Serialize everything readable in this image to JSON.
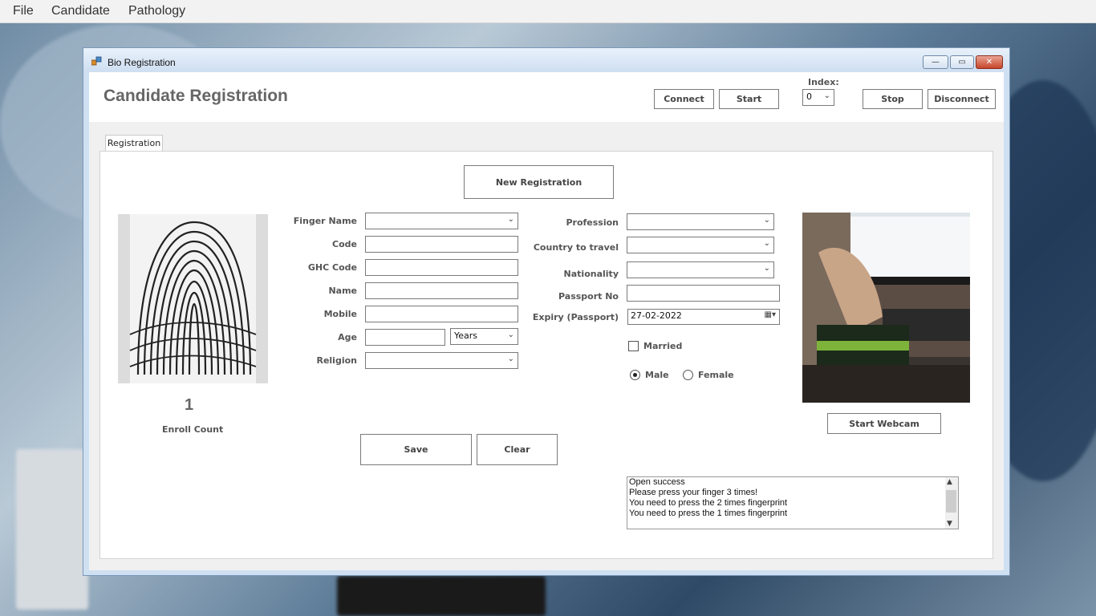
{
  "menubar": {
    "items": [
      "File",
      "Candidate",
      "Pathology"
    ]
  },
  "window": {
    "title": "Bio Registration",
    "controls": {
      "minimize": "—",
      "maximize": "▭",
      "close": "✕"
    }
  },
  "header": {
    "title": "Candidate Registration",
    "connect_label": "Connect",
    "start_label": "Start",
    "index_label": "Index:",
    "index_value": "0",
    "stop_label": "Stop",
    "disconnect_label": "Disconnect"
  },
  "tabs": [
    {
      "label": "Registration"
    }
  ],
  "form": {
    "new_registration_label": "New Registration",
    "enroll_count": "1",
    "enroll_count_label": "Enroll Count",
    "left_fields": {
      "finger_name": {
        "label": "Finger Name",
        "value": ""
      },
      "code": {
        "label": "Code",
        "value": ""
      },
      "ghc_code": {
        "label": "GHC Code",
        "value": ""
      },
      "name": {
        "label": "Name",
        "value": ""
      },
      "mobile": {
        "label": "Mobile",
        "value": ""
      },
      "age": {
        "label": "Age",
        "value": "",
        "unit": "Years"
      },
      "religion": {
        "label": "Religion",
        "value": ""
      }
    },
    "right_fields": {
      "profession": {
        "label": "Profession",
        "value": ""
      },
      "country": {
        "label": "Country to travel",
        "value": ""
      },
      "nationality": {
        "label": "Nationality",
        "value": ""
      },
      "passport_no": {
        "label": "Passport No",
        "value": ""
      },
      "expiry": {
        "label": "Expiry (Passport)",
        "value": "27-02-2022"
      }
    },
    "married_label": "Married",
    "married_checked": false,
    "gender": {
      "male_label": "Male",
      "female_label": "Female",
      "selected": "Male"
    },
    "save_label": "Save",
    "clear_label": "Clear",
    "webcam_button_label": "Start Webcam"
  },
  "log": {
    "lines": [
      "Open success",
      "Please press your finger 3 times!",
      "You need to press the 2 times fingerprint",
      "You need to press the 1 times fingerprint"
    ]
  }
}
